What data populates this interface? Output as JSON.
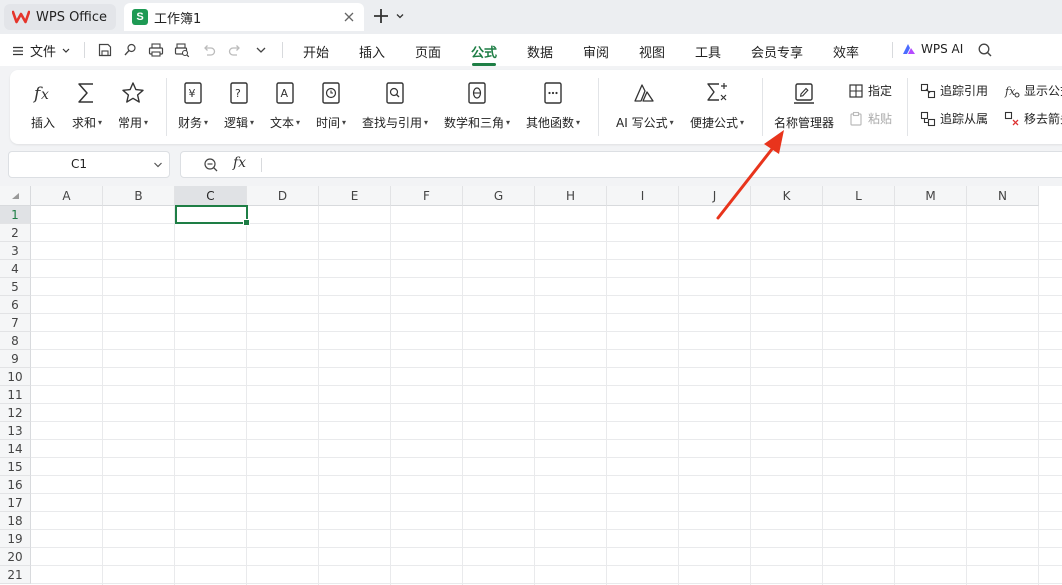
{
  "app_tab": {
    "label": "WPS Office"
  },
  "doc_tab": {
    "icon_letter": "S",
    "label": "工作簿1"
  },
  "menu": {
    "file_label": "文件",
    "tabs": [
      "开始",
      "插入",
      "页面",
      "公式",
      "数据",
      "审阅",
      "视图",
      "工具",
      "会员专享",
      "效率"
    ],
    "active_tab": "公式",
    "wps_ai_label": "WPS AI"
  },
  "ribbon": {
    "insert_func": "插入",
    "sum": "求和",
    "common": "常用",
    "finance": "财务",
    "logic": "逻辑",
    "text": "文本",
    "time": "时间",
    "lookup": "查找与引用",
    "math": "数学和三角",
    "other": "其他函数",
    "ai_formula": "AI 写公式",
    "quick_formula": "便捷公式",
    "name_manager": "名称管理器",
    "specify": "指定",
    "paste": "粘贴",
    "trace_precedents": "追踪引用",
    "trace_dependents": "追踪从属",
    "show_formulas": "显示公式",
    "remove_arrows": "移去箭头"
  },
  "formula_bar": {
    "cell_ref": "C1",
    "fx_label": "fx",
    "content": ""
  },
  "grid": {
    "columns": [
      "A",
      "B",
      "C",
      "D",
      "E",
      "F",
      "G",
      "H",
      "I",
      "J",
      "K",
      "L",
      "M",
      "N"
    ],
    "rows": [
      "1",
      "2",
      "3",
      "4",
      "5",
      "6",
      "7",
      "8",
      "9",
      "10",
      "11",
      "12",
      "13",
      "14",
      "15",
      "16",
      "17",
      "18",
      "19",
      "20",
      "21"
    ],
    "selected_column": "C",
    "selected_row": "1"
  },
  "colors": {
    "accent": "#1e7e45",
    "annotation_arrow": "#e8341c",
    "wps_red": "#e5352b",
    "sheet_green": "#1e9a54"
  }
}
